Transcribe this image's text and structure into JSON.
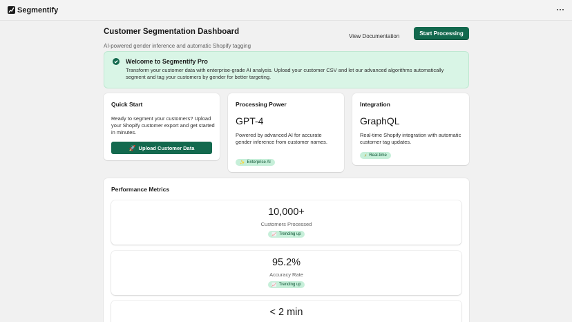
{
  "app": {
    "name": "Segmentify"
  },
  "header": {
    "title": "Customer Segmentation Dashboard",
    "subtitle": "AI-powered gender inference and automatic Shopify tagging",
    "secondary_action": "View Documentation",
    "primary_action": "Start Processing"
  },
  "banner": {
    "title": "Welcome to Segmentify Pro",
    "text": "Transform your customer data with enterprise-grade AI analysis. Upload your customer CSV and let our advanced algorithms automatically segment and tag your customers by gender for better targeting."
  },
  "cards": {
    "quick_start": {
      "title": "Quick Start",
      "text": "Ready to segment your customers? Upload your Shopify customer export and get started in minutes.",
      "button_icon": "🚀",
      "button_label": "Upload Customer Data"
    },
    "processing": {
      "title": "Processing Power",
      "value": "GPT-4",
      "text": "Powered by advanced AI for accurate gender inference from customer names.",
      "badge_icon": "✨",
      "badge": "Enterprise AI"
    },
    "integration": {
      "title": "Integration",
      "value": "GraphQL",
      "text": "Real-time Shopify integration with automatic customer tag updates.",
      "badge_icon": "⚡",
      "badge": "Real-time"
    }
  },
  "metrics": {
    "title": "Performance Metrics",
    "items": [
      {
        "value": "10,000+",
        "label": "Customers Processed",
        "badge_icon": "📈",
        "badge": "Trending up"
      },
      {
        "value": "95.2%",
        "label": "Accuracy Rate",
        "badge_icon": "📈",
        "badge": "Trending up"
      },
      {
        "value": "< 2 min"
      }
    ]
  },
  "colors": {
    "primary": "#13694e",
    "banner_bg": "#d9f5e6",
    "badge_bg": "#c6efd9",
    "page_bg": "#f1f1f1"
  }
}
